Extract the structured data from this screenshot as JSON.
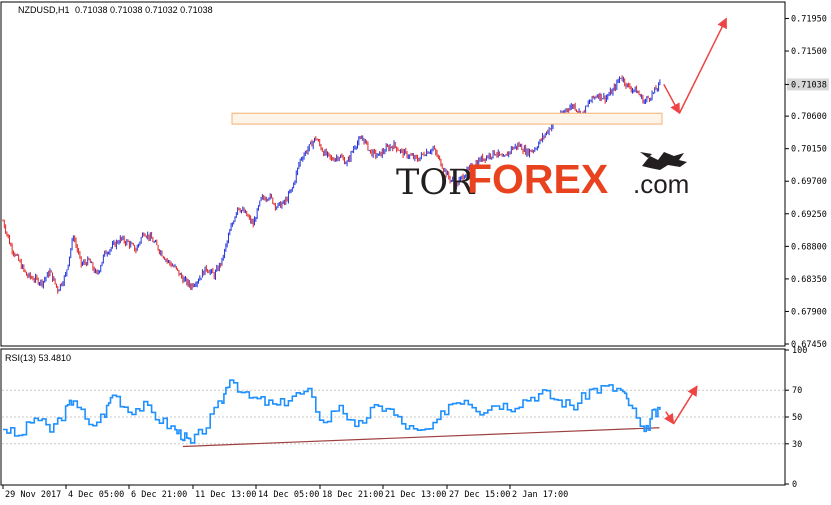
{
  "chart_data": [
    {
      "type": "line",
      "title": "NZDUSD,H1",
      "ohlc_readout": "0.71038 0.71038 0.71032 0.71038",
      "price_badge": "0.71038",
      "colors": {
        "bull_bar": "#2233dd",
        "bear_bar": "#dd2222",
        "zone_fill": "#fff4e8",
        "zone_stroke": "#f5b070",
        "arrow": "#ee4444",
        "badge_bg": "#d8d8d8"
      },
      "ylim": [
        0.6745,
        0.7215
      ],
      "y_ticks": [
        "0.71950",
        "0.71500",
        "0.71038",
        "0.70600",
        "0.70150",
        "0.69700",
        "0.69250",
        "0.68800",
        "0.68350",
        "0.67900",
        "0.67450"
      ],
      "x_labels": [
        "29 Nov 2017",
        "4 Dec 05:00",
        "6 Dec 21:00",
        "11 Dec 13:00",
        "14 Dec 05:00",
        "18 Dec 21:00",
        "21 Dec 13:00",
        "27 Dec 15:00",
        "2 Jan 17:00"
      ],
      "series": [
        {
          "values": [
            [
              0,
              0.6915
            ],
            [
              1,
              0.688
            ],
            [
              2,
              0.686
            ],
            [
              3,
              0.684
            ],
            [
              4,
              0.6835
            ],
            [
              5,
              0.683
            ],
            [
              6,
              0.6845
            ],
            [
              7,
              0.682
            ],
            [
              8,
              0.684
            ],
            [
              9,
              0.6895
            ],
            [
              10,
              0.6855
            ],
            [
              11,
              0.686
            ],
            [
              12,
              0.684
            ],
            [
              13,
              0.687
            ],
            [
              14,
              0.688
            ],
            [
              15,
              0.689
            ],
            [
              16,
              0.6885
            ],
            [
              17,
              0.6875
            ],
            [
              18,
              0.69
            ],
            [
              19,
              0.689
            ],
            [
              20,
              0.6875
            ],
            [
              21,
              0.686
            ],
            [
              22,
              0.685
            ],
            [
              23,
              0.6835
            ],
            [
              24,
              0.6825
            ],
            [
              25,
              0.6835
            ],
            [
              26,
              0.685
            ],
            [
              27,
              0.684
            ],
            [
              28,
              0.686
            ],
            [
              29,
              0.69
            ],
            [
              30,
              0.6935
            ],
            [
              31,
              0.6925
            ],
            [
              32,
              0.691
            ],
            [
              33,
              0.6945
            ],
            [
              34,
              0.695
            ],
            [
              35,
              0.6935
            ],
            [
              36,
              0.694
            ],
            [
              37,
              0.696
            ],
            [
              38,
              0.7
            ],
            [
              39,
              0.7015
            ],
            [
              40,
              0.703
            ],
            [
              41,
              0.701
            ],
            [
              42,
              0.7
            ],
            [
              43,
              0.7005
            ],
            [
              44,
              0.6995
            ],
            [
              45,
              0.702
            ],
            [
              46,
              0.703
            ],
            [
              47,
              0.701
            ],
            [
              48,
              0.7005
            ],
            [
              49,
              0.7015
            ],
            [
              50,
              0.702
            ],
            [
              51,
              0.701
            ],
            [
              52,
              0.7005
            ],
            [
              53,
              0.7
            ],
            [
              54,
              0.701
            ],
            [
              55,
              0.7015
            ],
            [
              56,
              0.6995
            ],
            [
              57,
              0.6975
            ],
            [
              58,
              0.6965
            ],
            [
              59,
              0.698
            ],
            [
              60,
              0.699
            ],
            [
              61,
              0.7
            ],
            [
              62,
              0.7005
            ],
            [
              63,
              0.701
            ],
            [
              64,
              0.7
            ],
            [
              65,
              0.7015
            ],
            [
              66,
              0.702
            ],
            [
              67,
              0.701
            ],
            [
              68,
              0.7015
            ],
            [
              69,
              0.703
            ],
            [
              70,
              0.7045
            ],
            [
              71,
              0.7055
            ],
            [
              72,
              0.707
            ],
            [
              73,
              0.7075
            ],
            [
              74,
              0.706
            ],
            [
              75,
              0.708
            ],
            [
              76,
              0.709
            ],
            [
              77,
              0.7085
            ],
            [
              78,
              0.7095
            ],
            [
              79,
              0.7115
            ],
            [
              80,
              0.71
            ],
            [
              81,
              0.7095
            ],
            [
              82,
              0.708
            ],
            [
              83,
              0.709
            ],
            [
              84,
              0.7104
            ]
          ]
        }
      ],
      "resistance_zone": [
        0.7049,
        0.7064
      ],
      "forecast_arrows": [
        {
          "from": [
            84.5,
            0.7104
          ],
          "to": [
            86.5,
            0.7064
          ]
        },
        {
          "from": [
            86.5,
            0.7064
          ],
          "to": [
            92.5,
            0.7195
          ]
        }
      ],
      "watermark_logo": {
        "part1": "TOR",
        "part2": "FOREX",
        "part3": ".com"
      }
    },
    {
      "type": "line",
      "title": "RSI(13) 53.4810",
      "ylim": [
        0,
        100
      ],
      "y_ticks": [
        "100",
        "70",
        "50",
        "30",
        "0"
      ],
      "levels": [
        70,
        50,
        30
      ],
      "colors": {
        "line": "#1e90ff",
        "trendline": "#a04040",
        "arrow": "#ee4444"
      },
      "series": [
        {
          "values": [
            [
              0,
              42
            ],
            [
              2,
              35
            ],
            [
              4,
              50
            ],
            [
              6,
              40
            ],
            [
              8,
              55
            ],
            [
              9,
              64
            ],
            [
              11,
              42
            ],
            [
              13,
              53
            ],
            [
              14,
              68
            ],
            [
              16,
              55
            ],
            [
              18,
              58
            ],
            [
              20,
              48
            ],
            [
              22,
              40
            ],
            [
              23,
              36
            ],
            [
              24,
              30
            ],
            [
              26,
              44
            ],
            [
              28,
              63
            ],
            [
              29,
              80
            ],
            [
              31,
              65
            ],
            [
              33,
              62
            ],
            [
              35,
              58
            ],
            [
              37,
              66
            ],
            [
              39,
              68
            ],
            [
              41,
              45
            ],
            [
              43,
              60
            ],
            [
              45,
              40
            ],
            [
              47,
              55
            ],
            [
              49,
              58
            ],
            [
              51,
              45
            ],
            [
              53,
              38
            ],
            [
              55,
              42
            ],
            [
              57,
              60
            ],
            [
              59,
              64
            ],
            [
              61,
              55
            ],
            [
              63,
              60
            ],
            [
              65,
              58
            ],
            [
              67,
              64
            ],
            [
              69,
              68
            ],
            [
              71,
              62
            ],
            [
              73,
              58
            ],
            [
              75,
              70
            ],
            [
              77,
              72
            ],
            [
              79,
              70
            ],
            [
              80,
              60
            ],
            [
              82,
              36
            ],
            [
              83,
              52
            ],
            [
              84,
              53.5
            ]
          ]
        }
      ],
      "trendline": {
        "from": [
          23,
          28
        ],
        "to": [
          98,
          42
        ]
      },
      "forecast_arrows": [
        {
          "from": [
            84.5,
            54
          ],
          "to": [
            85.5,
            45
          ]
        },
        {
          "from": [
            85.5,
            45
          ],
          "to": [
            88.5,
            73
          ]
        }
      ]
    }
  ]
}
